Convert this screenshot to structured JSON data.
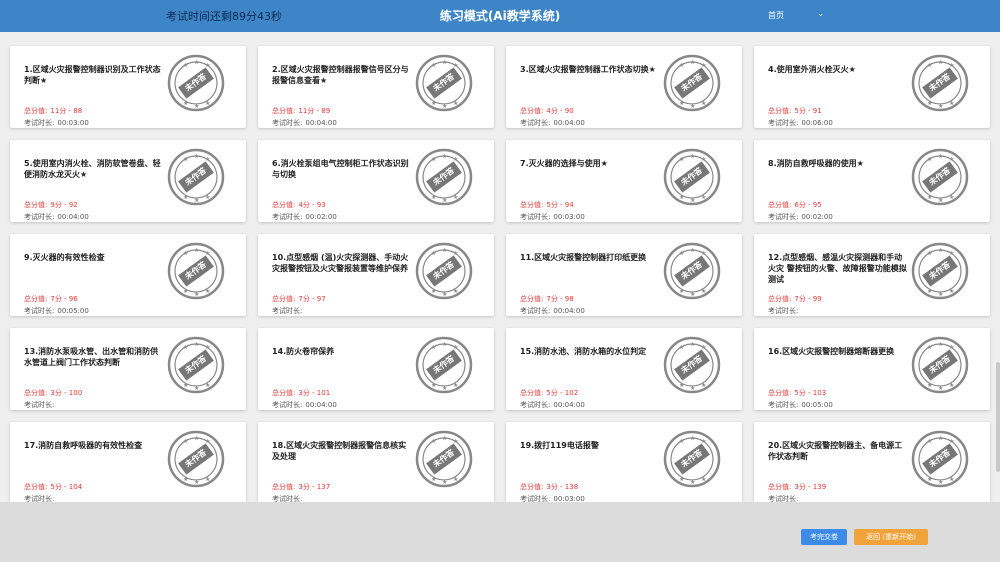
{
  "header": {
    "timer": "考试时间还剩89分43秒",
    "title": "练习模式(Ai教学系统)",
    "page_select": "首页"
  },
  "stamp_label": "未作答",
  "labels": {
    "score": "总分值:",
    "duration": "考试时长:"
  },
  "cards": [
    {
      "title": "1.区域火灾报警控制器识别及工作状态判断★",
      "score": "11分 - 88",
      "duration": "00:03:00"
    },
    {
      "title": "2.区域火灾报警控制器报警信号区分与报警信息查看★",
      "score": "11分 - 89",
      "duration": "00:04:00"
    },
    {
      "title": "3.区域火灾报警控制器工作状态切换★",
      "score": "4分 - 90",
      "duration": "00:04:00"
    },
    {
      "title": "4.使用室外消火栓灭火★",
      "score": "5分 - 91",
      "duration": "00:06:00"
    },
    {
      "title": "5.使用室内消火栓、消防软管卷盘、轻便消防水龙灭火★",
      "score": "9分 - 92",
      "duration": "00:04:00"
    },
    {
      "title": "6.消火栓泵组电气控制柜工作状态识别与切换",
      "score": "4分 - 93",
      "duration": "00:02:00"
    },
    {
      "title": "7.灭火器的选择与使用★",
      "score": "5分 - 94",
      "duration": "00:03:00"
    },
    {
      "title": "8.消防自救呼吸器的使用★",
      "score": "6分 - 95",
      "duration": "00:02:00"
    },
    {
      "title": "9.灭火器的有效性检查",
      "score": "7分 - 96",
      "duration": "00:05:00"
    },
    {
      "title": "10.点型感烟 (温)火灾探测器、手动火灾报警按钮及火灾警报装置等维护保养",
      "score": "7分 - 97",
      "duration": ""
    },
    {
      "title": "11.区域火灾报警控制器打印纸更换",
      "score": "7分 - 98",
      "duration": "00:04:00"
    },
    {
      "title": "12.点型感烟、感温火灾探测器和手动火灾 警按钮的火警、故障报警功能模拟测试",
      "score": "7分 - 99",
      "duration": ""
    },
    {
      "title": "13.消防水泵吸水管、出水管和消防供水管道上阀门工作状态判断",
      "score": "3分 - 100",
      "duration": ""
    },
    {
      "title": "14.防火卷帘保养",
      "score": "3分 - 101",
      "duration": "00:04:00"
    },
    {
      "title": "15.消防水池、消防水箱的水位判定",
      "score": "5分 - 102",
      "duration": "00:04:00"
    },
    {
      "title": "16.区域火灾报警控制器熔断器更换",
      "score": "5分 - 103",
      "duration": "00:05:00"
    },
    {
      "title": "17.消防自救呼吸器的有效性检查",
      "score": "5分 - 104",
      "duration": ""
    },
    {
      "title": "18.区域火灾报警控制器报警信息核实及处理",
      "score": "3分 - 137",
      "duration": ""
    },
    {
      "title": "19.拨打119电话报警",
      "score": "3分 - 138",
      "duration": "00:03:00"
    },
    {
      "title": "20.区域火灾报警控制器主、备电源工作状态判断",
      "score": "3分 - 139",
      "duration": ""
    }
  ],
  "footer": {
    "submit_label": "考完交卷",
    "back_label": "返回 (重新开始)"
  },
  "colors": {
    "header": "#3d85c6",
    "score": "#e53935",
    "submit": "#3d8be6",
    "back": "#f0a33a",
    "stamp": "#777777"
  }
}
